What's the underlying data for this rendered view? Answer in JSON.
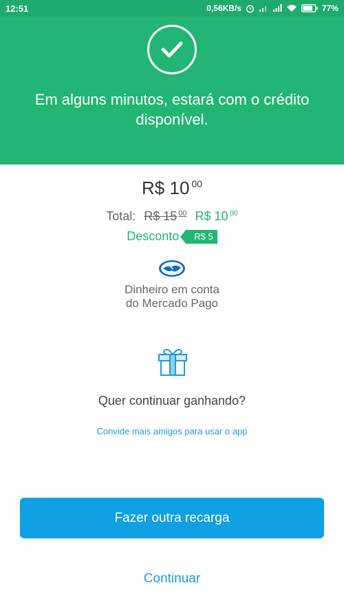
{
  "status_bar": {
    "time": "12:51",
    "network_speed": "0,56KB/s",
    "battery": "77%",
    "icons": [
      "alarm-icon",
      "signal-icon",
      "signal-icon",
      "wifi-icon",
      "battery-icon"
    ]
  },
  "hero": {
    "icon": "checkmark-icon",
    "message": "Em alguns minutos, estará com o crédito disponível.",
    "background_color": "#22b573"
  },
  "amount": {
    "currency": "R$",
    "integer": "10",
    "cents": "00"
  },
  "total": {
    "label": "Total:",
    "old_price": "R$ 15",
    "old_price_cents": "00",
    "new_price": "R$ 10",
    "new_price_cents": "00"
  },
  "discount": {
    "label": "Desconto",
    "tag": "R$ 5"
  },
  "payment_method": {
    "icon": "mercado-pago-handshake-icon",
    "line1": "Dinheiro em conta",
    "line2": "do Mercado Pago"
  },
  "referral": {
    "icon": "gift-icon",
    "question": "Quer continuar ganhando?",
    "link": "Convide mais amigos para usar o app"
  },
  "actions": {
    "primary_button": "Fazer outra recarga",
    "secondary_link": "Continuar"
  },
  "colors": {
    "brand_green": "#22b573",
    "primary_blue": "#0ea0e0",
    "link_blue": "#1a9ed6"
  }
}
